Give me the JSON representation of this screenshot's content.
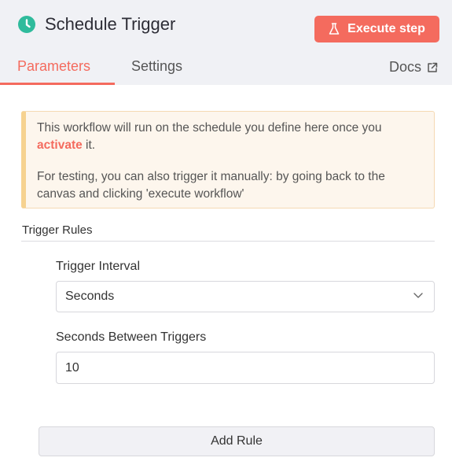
{
  "header": {
    "title": "Schedule Trigger",
    "execute_label": "Execute step",
    "clock_icon": "clock-icon",
    "flask_icon": "flask-icon"
  },
  "tabs": {
    "parameters": "Parameters",
    "settings": "Settings",
    "docs": "Docs",
    "active": "Parameters"
  },
  "notice": {
    "line1_before": "This workflow will run on the schedule you define here once you ",
    "line1_link": "activate",
    "line1_after": " it.",
    "line2": "For testing, you can also trigger it manually: by going back to the canvas and clicking 'execute workflow'"
  },
  "rules": {
    "section_title": "Trigger Rules",
    "interval_label": "Trigger Interval",
    "interval_value": "Seconds",
    "seconds_label": "Seconds Between Triggers",
    "seconds_value": "10",
    "add_rule_label": "Add Rule"
  },
  "colors": {
    "accent": "#f46b5e",
    "icon_green": "#2fbb9c",
    "header_bg": "#f0f1f5",
    "notice_bg": "#fdf6ed",
    "notice_border": "#f6d290"
  }
}
